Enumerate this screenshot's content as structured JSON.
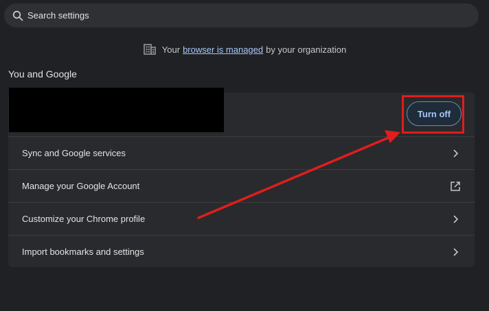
{
  "search": {
    "placeholder": "Search settings",
    "icon": "search-icon"
  },
  "managed_notice": {
    "prefix": "Your",
    "link_text": "browser is managed",
    "suffix": "by your organization",
    "icon": "building-icon"
  },
  "section": {
    "title": "You and Google"
  },
  "profile": {
    "turn_off_label": "Turn off"
  },
  "rows": [
    {
      "label": "Sync and Google services",
      "icon": "chevron-right-icon"
    },
    {
      "label": "Manage your Google Account",
      "icon": "external-link-icon"
    },
    {
      "label": "Customize your Chrome profile",
      "icon": "chevron-right-icon"
    },
    {
      "label": "Import bookmarks and settings",
      "icon": "chevron-right-icon"
    }
  ],
  "colors": {
    "background": "#202124",
    "card": "#292a2d",
    "accent": "#a8c7fa",
    "annotation": "#e11d1d"
  }
}
